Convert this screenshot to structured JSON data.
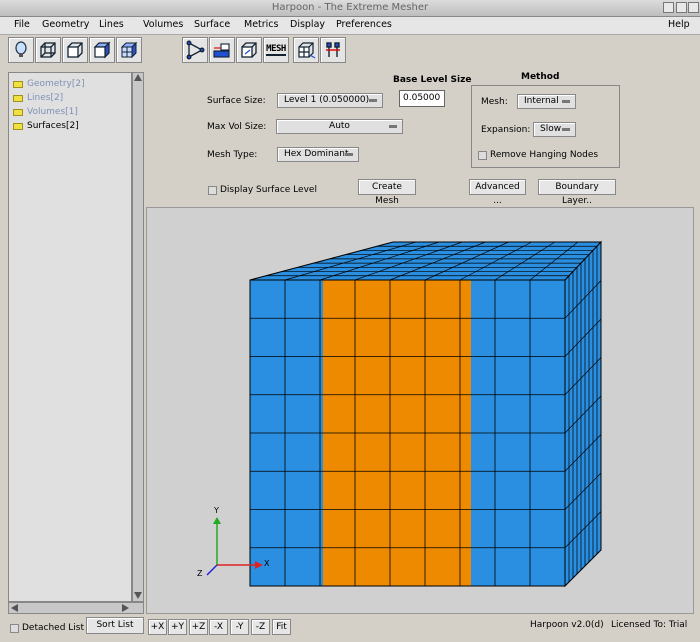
{
  "window": {
    "title": "Harpoon - The Extreme Mesher"
  },
  "menu": [
    "File",
    "Geometry",
    "Lines",
    "Volumes",
    "Surface",
    "Metrics",
    "Display",
    "Preferences"
  ],
  "menu_help": "Help",
  "toolbar": {
    "left_icons": [
      "lightbulb-icon",
      "cube-wire-icon",
      "cube-face-icon",
      "cube-solid-icon",
      "cube-mesh-icon"
    ],
    "right_icons": [
      "triangle-nodes-icon",
      "laser-icon",
      "cube-arrow-icon",
      "mesh-text-icon",
      "cube-export-icon",
      "tools-icon"
    ],
    "mesh_icon_label": "MESH"
  },
  "tree": {
    "items": [
      {
        "label": "Geometry[2]",
        "dimmed": true
      },
      {
        "label": "Lines[2]",
        "dimmed": true
      },
      {
        "label": "Volumes[1]",
        "dimmed": true
      },
      {
        "label": "Surfaces[2]",
        "dimmed": false
      }
    ]
  },
  "params": {
    "base_level_title": "Base Level Size",
    "base_level_value": "0.05000",
    "surface_size_label": "Surface Size:",
    "surface_size_value": "Level 1 (0.050000)",
    "max_vol_label": "Max Vol Size:",
    "max_vol_value": "Auto",
    "mesh_type_label": "Mesh Type:",
    "mesh_type_value": "Hex Dominant",
    "display_surface_label": "Display Surface Level",
    "create_mesh": "Create Mesh",
    "advanced": "Advanced ...",
    "boundary_layer": "Boundary Layer.."
  },
  "method": {
    "title": "Method",
    "mesh_label": "Mesh:",
    "mesh_value": "Internal",
    "expansion_label": "Expansion:",
    "expansion_value": "Slow",
    "remove_label": "Remove Hanging Nodes"
  },
  "bottom": {
    "detached_list": "Detached List",
    "sort_list": "Sort List",
    "view_buttons": [
      "+X",
      "+Y",
      "+Z",
      "-X",
      "-Y",
      "-Z",
      "Fit"
    ],
    "version": "Harpoon v2.0(d)",
    "license": "Licensed To: Trial"
  },
  "axes": {
    "x": "X",
    "y": "Y",
    "z": "Z"
  },
  "colors": {
    "mesh_blue": "#2a8fe0",
    "mesh_orange": "#ee8a00",
    "grid": "#000000"
  }
}
